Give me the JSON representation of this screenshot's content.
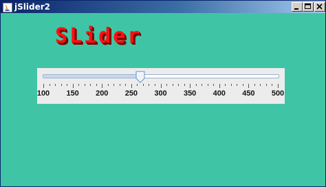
{
  "window": {
    "title": "jSlider2",
    "controls": [
      "minimize",
      "maximize",
      "close"
    ]
  },
  "heading": "SLider",
  "slider": {
    "min": 100,
    "max": 500,
    "value": 265,
    "major_tick_spacing": 50,
    "minor_tick_spacing": 10,
    "labels": [
      "100",
      "150",
      "200",
      "250",
      "300",
      "350",
      "400",
      "450",
      "500"
    ]
  },
  "colors": {
    "background": "#3fc5a6",
    "heading": "#ff1010",
    "heading_shadow": "#7a0000",
    "titlebar_start": "#0a246a",
    "titlebar_end": "#a6caf0"
  }
}
